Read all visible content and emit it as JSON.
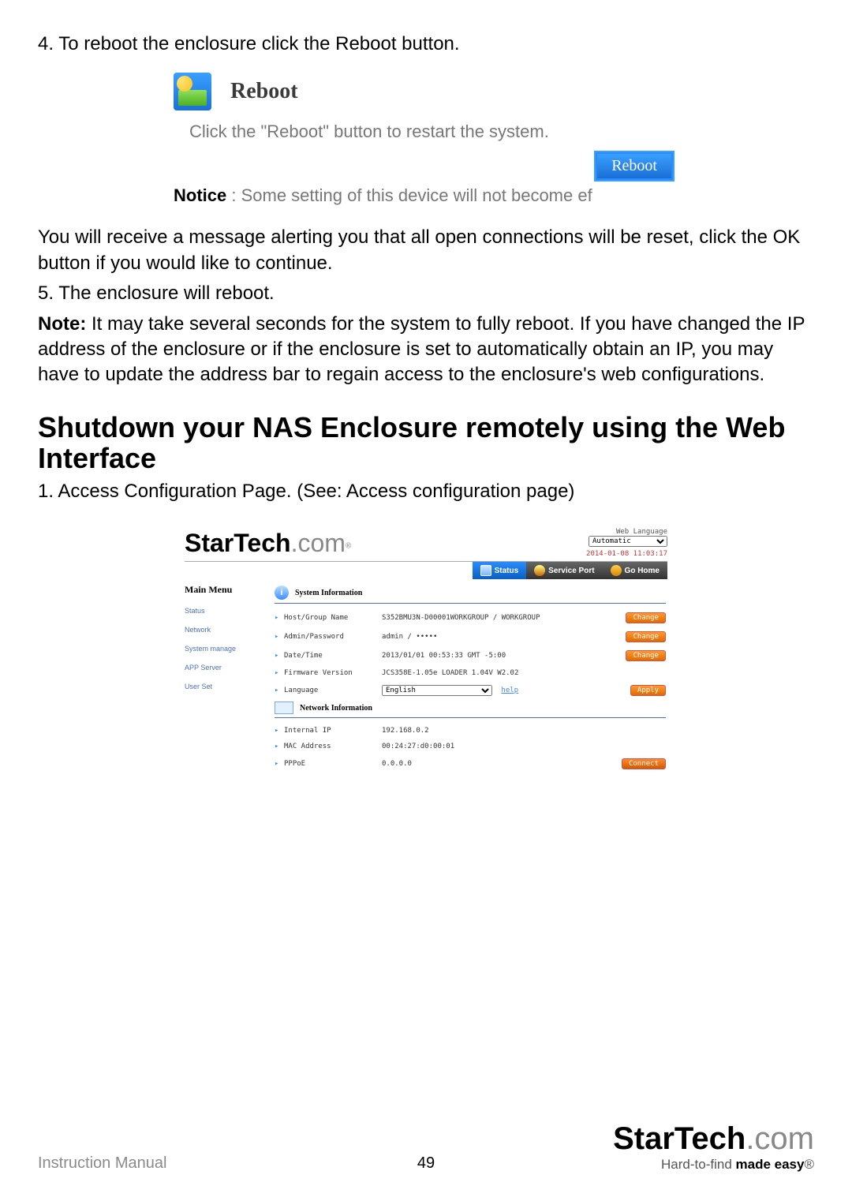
{
  "step4": "4.  To reboot the enclosure click the Reboot button.",
  "reboot": {
    "title": "Reboot",
    "sub": "Click the \"Reboot\" button to restart the system.",
    "button": "Reboot",
    "notice_label": "Notice",
    "notice_rest": " :   Some setting of this device will not become ef"
  },
  "para_after": "You will receive a message alerting you that all open connections will be reset, click the OK button if you would like to continue.",
  "step5": "5.  The enclosure will reboot.",
  "note_label": "Note:",
  "note_rest": " It may take several seconds for the system to fully reboot. If you have changed the IP address of the enclosure or if the enclosure is set to automatically obtain an IP, you may have to update the address bar to regain access to the enclosure's web configurations.",
  "heading": "Shutdown your NAS Enclosure remotely using the Web Interface",
  "step1_cfg": "1.  Access Configuration Page. (See: Access configuration page)",
  "config": {
    "logo1": "StarTech",
    "logo2": ".com",
    "lang_label": "Web Language",
    "lang_value": "Automatic",
    "timestamp": "2014-01-08 11:03:17",
    "tabs": {
      "status": "Status",
      "port": "Service Port",
      "home": "Go Home"
    },
    "sidebar_title": "Main Menu",
    "nav": [
      "Status",
      "Network",
      "System manage",
      "APP Server",
      "User Set"
    ],
    "sys_title": "System Information",
    "rows": {
      "host_k": "Host/Group Name",
      "host_v": "S352BMU3N-D00001WORKGROUP / WORKGROUP",
      "admin_k": "Admin/Password",
      "admin_v": "admin / •••••",
      "date_k": "Date/Time",
      "date_v": "2013/01/01 00:53:33 GMT -5:00",
      "fw_k": "Firmware Version",
      "fw_v": "JCS358E-1.05e LOADER 1.04V W2.02",
      "lang_k": "Language",
      "lang_v": "English",
      "help": "help"
    },
    "net_title": "Network Information",
    "net": {
      "ip_k": "Internal IP",
      "ip_v": "192.168.0.2",
      "mac_k": "MAC Address",
      "mac_v": "00:24:27:d0:00:01",
      "pppoe_k": "PPPoE",
      "pppoe_v": "0.0.0.0"
    },
    "btn": {
      "change": "Change",
      "apply": "Apply",
      "connect": "Connect"
    }
  },
  "footer": {
    "manual": "Instruction Manual",
    "page": "49",
    "brand1": "StarTech",
    "brand2": ".com",
    "tag_pre": "Hard-to-find ",
    "tag_bold": "made easy",
    "tag_reg": "®"
  }
}
